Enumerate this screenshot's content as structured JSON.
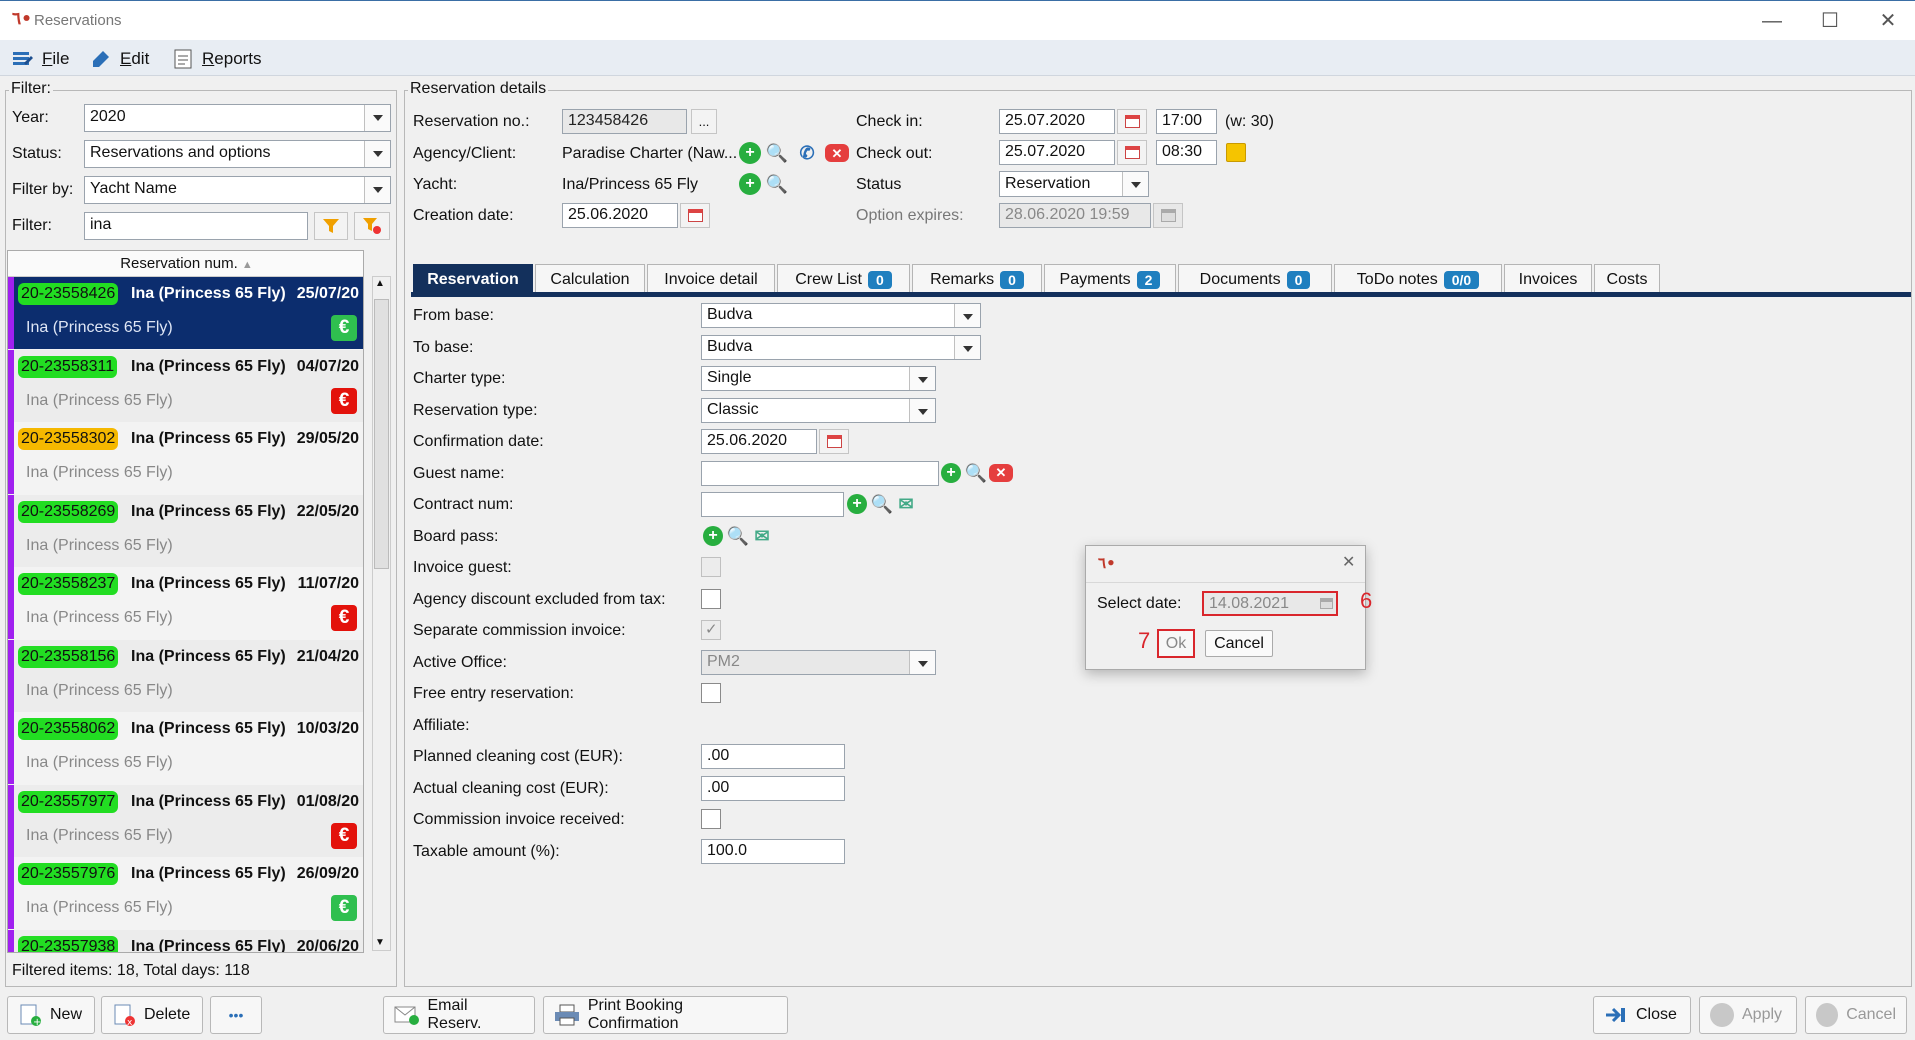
{
  "window": {
    "title": "Reservations"
  },
  "menu": {
    "file": "File",
    "edit": "Edit",
    "reports": "Reports"
  },
  "filter": {
    "group_label": "Filter:",
    "year_label": "Year:",
    "year": "2020",
    "status_label": "Status:",
    "status": "Reservations and options",
    "filterby_label": "Filter by:",
    "filterby": "Yacht Name",
    "filter_label": "Filter:",
    "filter_value": "ina"
  },
  "list": {
    "header": "Reservation num.",
    "items": [
      {
        "num": "20-23558426",
        "yacht": "Ina (Princess 65 Fly)",
        "date": "25/07/20",
        "sub": "Ina (Princess 65 Fly)",
        "eur": "€",
        "badge": "#22dd22",
        "eur_color": "#2fbf4f"
      },
      {
        "num": "20-23558311",
        "yacht": "Ina (Princess 65 Fly)",
        "date": "04/07/20",
        "sub": "Ina (Princess 65 Fly)",
        "eur": "€",
        "badge": "#22dd22",
        "eur_color": "#e3120b"
      },
      {
        "num": "20-23558302",
        "yacht": "Ina (Princess 65 Fly)",
        "date": "29/05/20",
        "sub": "Ina (Princess 65 Fly)",
        "eur": "",
        "badge": "#f5b800",
        "eur_color": ""
      },
      {
        "num": "20-23558269",
        "yacht": "Ina (Princess 65 Fly)",
        "date": "22/05/20",
        "sub": "Ina (Princess 65 Fly)",
        "eur": "",
        "badge": "#22dd22",
        "eur_color": ""
      },
      {
        "num": "20-23558237",
        "yacht": "Ina (Princess 65 Fly)",
        "date": "11/07/20",
        "sub": "Ina (Princess 65 Fly)",
        "eur": "€",
        "badge": "#22dd22",
        "eur_color": "#e3120b"
      },
      {
        "num": "20-23558156",
        "yacht": "Ina (Princess 65 Fly)",
        "date": "21/04/20",
        "sub": "Ina (Princess 65 Fly)",
        "eur": "",
        "badge": "#22dd22",
        "eur_color": ""
      },
      {
        "num": "20-23558062",
        "yacht": "Ina (Princess 65 Fly)",
        "date": "10/03/20",
        "sub": "Ina (Princess 65 Fly)",
        "eur": "",
        "badge": "#22dd22",
        "eur_color": ""
      },
      {
        "num": "20-23557977",
        "yacht": "Ina (Princess 65 Fly)",
        "date": "01/08/20",
        "sub": "Ina (Princess 65 Fly)",
        "eur": "€",
        "badge": "#22dd22",
        "eur_color": "#e3120b"
      },
      {
        "num": "20-23557976",
        "yacht": "Ina (Princess 65 Fly)",
        "date": "26/09/20",
        "sub": "Ina (Princess 65 Fly)",
        "eur": "€",
        "badge": "#22dd22",
        "eur_color": "#2fbf4f"
      },
      {
        "num": "20-23557938",
        "yacht": "Ina (Princess 65 Fly)",
        "date": "20/06/20",
        "sub": "",
        "eur": "",
        "badge": "#22dd22",
        "eur_color": ""
      }
    ],
    "status": "Filtered items: 18,  Total days: 118"
  },
  "details": {
    "group_label": "Reservation details",
    "resno_label": "Reservation no.:",
    "resno": "123458426",
    "agency_label": "Agency/Client:",
    "agency": "Paradise Charter (Naw...",
    "yacht_label": "Yacht:",
    "yacht": "Ina/Princess 65 Fly",
    "created_label": "Creation date:",
    "created": "25.06.2020",
    "checkin_label": "Check in:",
    "checkin_date": "25.07.2020",
    "checkin_time": "17:00",
    "week": "(w: 30)",
    "checkout_label": "Check out:",
    "checkout_date": "25.07.2020",
    "checkout_time": "08:30",
    "status_label": "Status",
    "status": "Reservation",
    "option_label": "Option expires:",
    "option": "28.06.2020 19:59"
  },
  "tabs": [
    {
      "label": "Reservation",
      "badge": ""
    },
    {
      "label": "Calculation",
      "badge": ""
    },
    {
      "label": "Invoice detail",
      "badge": ""
    },
    {
      "label": "Crew List",
      "badge": "0"
    },
    {
      "label": "Remarks",
      "badge": "0"
    },
    {
      "label": "Payments",
      "badge": "2"
    },
    {
      "label": "Documents",
      "badge": "0"
    },
    {
      "label": "ToDo notes",
      "badge": "0/0"
    },
    {
      "label": "Invoices",
      "badge": ""
    },
    {
      "label": "Costs",
      "badge": ""
    }
  ],
  "form": {
    "from_base_label": "From base:",
    "from_base": "Budva",
    "to_base_label": "To base:",
    "to_base": "Budva",
    "charter_type_label": "Charter type:",
    "charter_type": "Single",
    "res_type_label": "Reservation type:",
    "res_type": "Classic",
    "confirm_label": "Confirmation date:",
    "confirm": "25.06.2020",
    "guest_label": "Guest name:",
    "contract_label": "Contract num:",
    "board_label": "Board pass:",
    "invoice_guest_label": "Invoice guest:",
    "agency_disc_label": "Agency discount excluded from tax:",
    "sep_comm_label": "Separate commission invoice:",
    "office_label": "Active Office:",
    "office": "PM2",
    "free_entry_label": "Free entry reservation:",
    "affiliate_label": "Affiliate:",
    "planned_label": "Planned cleaning cost (EUR):",
    "planned": ".00",
    "actual_label": "Actual cleaning cost (EUR):",
    "actual": ".00",
    "comm_recv_label": "Commission invoice received:",
    "taxable_label": "Taxable amount (%):",
    "taxable": "100.0"
  },
  "dialog": {
    "select_label": "Select date:",
    "date": "14.08.2021",
    "ok": "Ok",
    "cancel": "Cancel",
    "step6": "6",
    "step7": "7"
  },
  "bottom": {
    "new": "New",
    "delete": "Delete",
    "more": "•••",
    "email": "Email Reserv.",
    "print": "Print Booking Confirmation",
    "close": "Close",
    "apply": "Apply",
    "cancel": "Cancel"
  }
}
